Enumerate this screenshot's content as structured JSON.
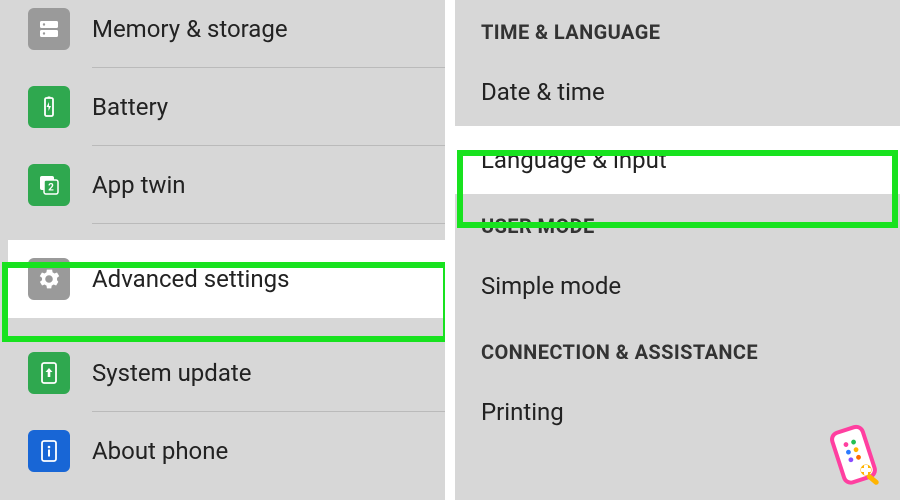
{
  "left": {
    "items": [
      {
        "id": "memory",
        "label": "Memory & storage",
        "highlight": false
      },
      {
        "id": "battery",
        "label": "Battery",
        "highlight": false
      },
      {
        "id": "apptwin",
        "label": "App twin",
        "highlight": false
      },
      {
        "id": "advanced",
        "label": "Advanced settings",
        "highlight": true
      },
      {
        "id": "update",
        "label": "System update",
        "highlight": false
      },
      {
        "id": "about",
        "label": "About phone",
        "highlight": false
      }
    ]
  },
  "right": {
    "sections": [
      {
        "title": "TIME & LANGUAGE",
        "items": [
          {
            "id": "datetime",
            "label": "Date & time",
            "highlight": false
          },
          {
            "id": "language",
            "label": "Language & input",
            "highlight": true
          }
        ]
      },
      {
        "title": "USER MODE",
        "items": [
          {
            "id": "simple",
            "label": "Simple mode",
            "highlight": false
          }
        ]
      },
      {
        "title": "CONNECTION & ASSISTANCE",
        "items": [
          {
            "id": "printing",
            "label": "Printing",
            "highlight": false
          }
        ]
      }
    ]
  },
  "colors": {
    "highlight": "#18e21f",
    "green": "#2fa84f",
    "gray": "#9a9a9a",
    "blue": "#1866d6"
  }
}
